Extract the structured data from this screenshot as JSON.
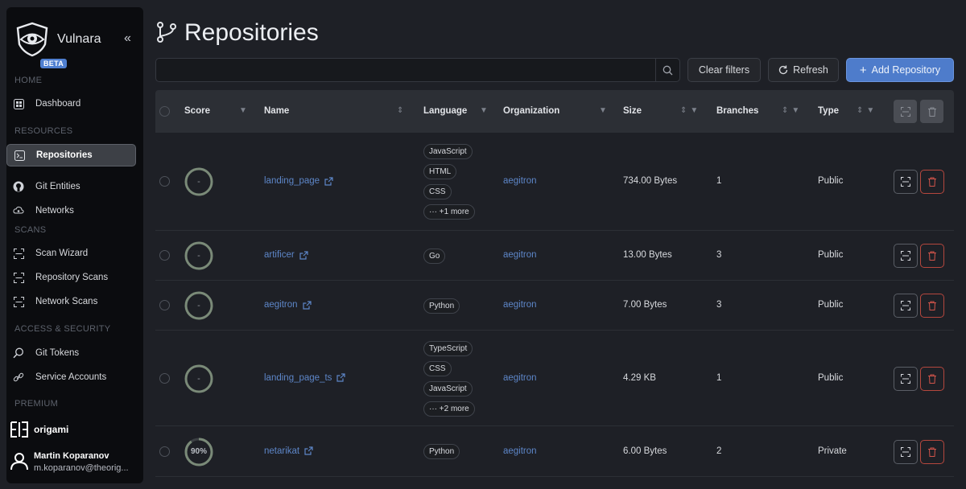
{
  "app": {
    "name": "Vulnara",
    "badge": "BETA"
  },
  "sidebar": {
    "sections": {
      "home": "HOME",
      "resources": "RESOURCES",
      "scans": "SCANS",
      "access": "ACCESS & SECURITY",
      "premium": "PREMIUM"
    },
    "items": [
      {
        "label": "Dashboard",
        "icon": "dashboard-icon"
      },
      {
        "label": "Repositories",
        "icon": "terminal-icon",
        "active": true
      },
      {
        "label": "Git Entities",
        "icon": "github-icon"
      },
      {
        "label": "Networks",
        "icon": "cloud-network-icon"
      },
      {
        "label": "Scan Wizard",
        "icon": "scan-icon"
      },
      {
        "label": "Repository Scans",
        "icon": "scan-icon"
      },
      {
        "label": "Network Scans",
        "icon": "scan-icon"
      },
      {
        "label": "Git Tokens",
        "icon": "search-key-icon"
      },
      {
        "label": "Service Accounts",
        "icon": "link-icon"
      }
    ],
    "org": {
      "name": "origami"
    },
    "user": {
      "name": "Martin Koparanov",
      "email": "m.koparanov@theorig..."
    }
  },
  "header": {
    "title": "Repositories",
    "search_placeholder": "",
    "clear_filters": "Clear filters",
    "refresh": "Refresh",
    "add": "Add Repository"
  },
  "table": {
    "columns": {
      "score": "Score",
      "name": "Name",
      "language": "Language",
      "organization": "Organization",
      "size": "Size",
      "branches": "Branches",
      "type": "Type"
    },
    "rows": [
      {
        "score": "-",
        "name": "landing_page",
        "languages": [
          "JavaScript",
          "HTML",
          "CSS",
          "··· +1 more"
        ],
        "organization": "aegitron",
        "size": "734.00 Bytes",
        "branches": "1",
        "type": "Public"
      },
      {
        "score": "-",
        "name": "artificer",
        "languages": [
          "Go"
        ],
        "organization": "aegitron",
        "size": "13.00 Bytes",
        "branches": "3",
        "type": "Public"
      },
      {
        "score": "-",
        "name": "aegitron",
        "languages": [
          "Python"
        ],
        "organization": "aegitron",
        "size": "7.00 Bytes",
        "branches": "3",
        "type": "Public"
      },
      {
        "score": "-",
        "name": "landing_page_ts",
        "languages": [
          "TypeScript",
          "CSS",
          "JavaScript",
          "··· +2 more"
        ],
        "organization": "aegitron",
        "size": "4.29 KB",
        "branches": "1",
        "type": "Public"
      },
      {
        "score": "90%",
        "score_value": 0.9,
        "name": "netarikat",
        "languages": [
          "Python"
        ],
        "organization": "aegitron",
        "size": "6.00 Bytes",
        "branches": "2",
        "type": "Private"
      }
    ]
  },
  "colors": {
    "accent": "#4e7ccb",
    "link": "#5d86c8",
    "danger": "#b5473e",
    "score_ring": "#7a8a78"
  }
}
